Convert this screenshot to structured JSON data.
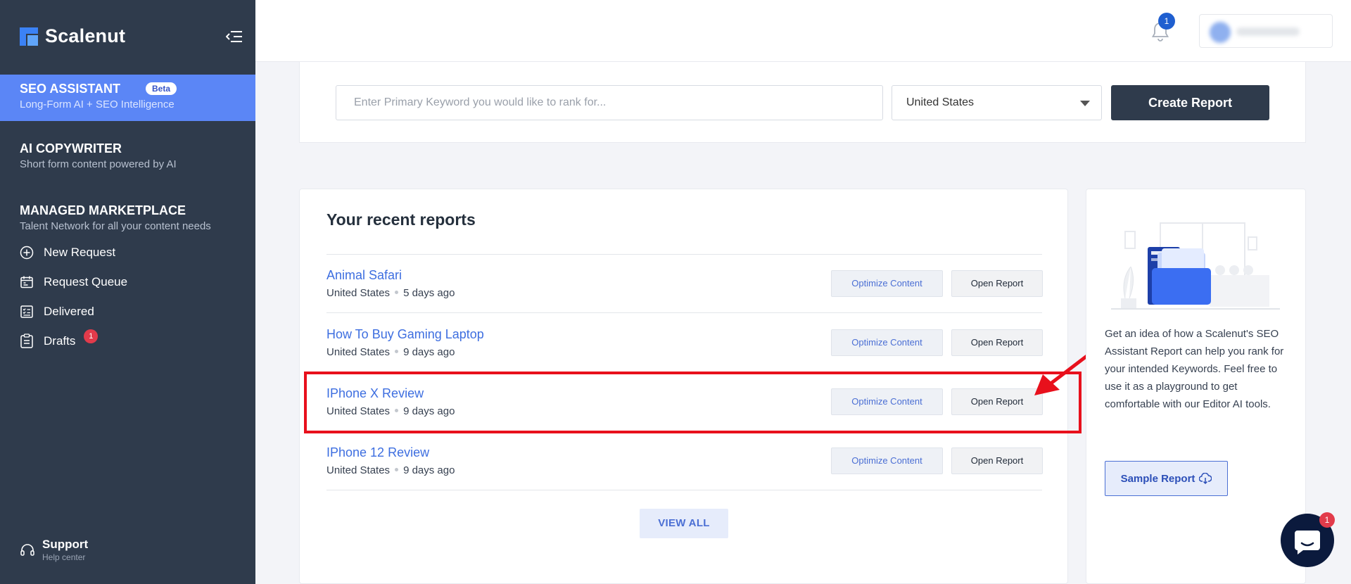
{
  "sidebar": {
    "logo_text": "Scalenut",
    "sections": [
      {
        "title": "SEO ASSISTANT",
        "subtitle": "Long-Form AI + SEO Intelligence",
        "badge": "Beta",
        "active": true
      },
      {
        "title": "AI COPYWRITER",
        "subtitle": "Short form content powered by AI"
      },
      {
        "title": "MANAGED MARKETPLACE",
        "subtitle": "Talent Network for all your content needs"
      }
    ],
    "items": [
      {
        "label": "New Request",
        "icon": "plus-circle-icon"
      },
      {
        "label": "Request Queue",
        "icon": "calendar-icon"
      },
      {
        "label": "Delivered",
        "icon": "checklist-icon"
      },
      {
        "label": "Drafts",
        "icon": "clipboard-icon",
        "badge": "1"
      }
    ],
    "support": {
      "label": "Support",
      "sublabel": "Help center",
      "icon": "headset-icon"
    }
  },
  "header": {
    "notification_count": "1"
  },
  "search": {
    "placeholder": "Enter Primary Keyword you would like to rank for...",
    "country": "United States",
    "create_label": "Create Report"
  },
  "reports": {
    "title": "Your recent reports",
    "optimize_label": "Optimize Content",
    "open_label": "Open Report",
    "view_all_label": "VIEW ALL",
    "rows": [
      {
        "title": "Animal Safari",
        "country": "United States",
        "age": "5 days ago"
      },
      {
        "title": "How To Buy Gaming Laptop",
        "country": "United States",
        "age": "9 days ago"
      },
      {
        "title": "IPhone X Review",
        "country": "United States",
        "age": "9 days ago"
      },
      {
        "title": "IPhone 12 Review",
        "country": "United States",
        "age": "9 days ago"
      }
    ]
  },
  "side_card": {
    "text": "Get an idea of how a Scalenut's SEO Assistant Report can help you rank for your intended Keywords. Feel free to use it as a playground to get comfortable with our Editor AI tools.",
    "sample_label": "Sample Report"
  },
  "chat": {
    "badge": "1"
  },
  "colors": {
    "sidebar_bg": "#2f3b4c",
    "accent": "#5b86f6",
    "link": "#3d6ee0",
    "highlight": "#e8101c"
  }
}
